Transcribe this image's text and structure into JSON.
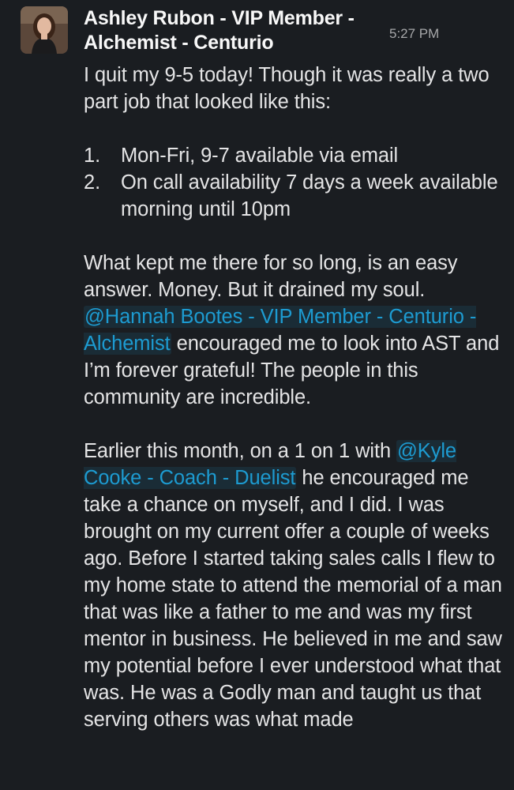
{
  "message": {
    "sender": "Ashley Rubon - VIP Member - Alchemist - Centurio",
    "timestamp": "5:27 PM",
    "intro": "I quit my 9-5 today! Though it was really a two part job that looked like this:",
    "list": [
      {
        "num": "1.",
        "text": "Mon-Fri, 9-7 available via email"
      },
      {
        "num": "2.",
        "text": "On call availability 7 days a week available morning until 10pm"
      }
    ],
    "p2_before": "What kept me there for so long, is an easy answer. Money. But it drained my soul. ",
    "mention1": "@Hannah Bootes - VIP Member - Centurio - Alchemist",
    "p2_after": " encouraged me to look into AST and I’m forever grateful! The people in this community are incredible.",
    "p3_before": "Earlier this month, on a 1 on 1 with ",
    "mention2": "@Kyle Cooke - Coach - Duelist",
    "p3_after": " he encouraged me take a chance on myself, and I did. I was brought on my current offer a couple of weeks ago. Before I started taking sales calls I flew to my home state to attend the memorial of a man that was like a father to me and was my first mentor in business. He believed in me and saw my potential before I ever understood what that was. He was a Godly man and taught us that serving others was what made"
  },
  "colors": {
    "background": "#1a1d21",
    "text": "#e4e4e5",
    "timestamp": "#a6a7a9",
    "mention": "#1d9bd1"
  }
}
